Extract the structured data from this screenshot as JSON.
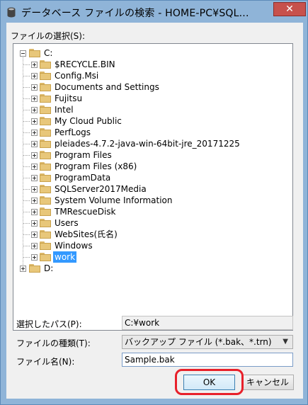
{
  "window": {
    "title": "データベース ファイルの検索 - HOME-PC¥SQL...",
    "close_glyph": "✕"
  },
  "dialog": {
    "file_select_label": "ファイルの選択(S):",
    "tree": {
      "drive_c": "C:",
      "folders": [
        {
          "name": "$RECYCLE.BIN"
        },
        {
          "name": "Config.Msi"
        },
        {
          "name": "Documents and Settings"
        },
        {
          "name": "Fujitsu"
        },
        {
          "name": "Intel"
        },
        {
          "name": "My Cloud Public"
        },
        {
          "name": "PerfLogs"
        },
        {
          "name": "pleiades-4.7.2-java-win-64bit-jre_20171225"
        },
        {
          "name": "Program Files"
        },
        {
          "name": "Program Files (x86)"
        },
        {
          "name": "ProgramData"
        },
        {
          "name": "SQLServer2017Media"
        },
        {
          "name": "System Volume Information"
        },
        {
          "name": "TMRescueDisk"
        },
        {
          "name": "Users"
        },
        {
          "name": "WebSites(氏名)"
        },
        {
          "name": "Windows"
        },
        {
          "name": "work"
        }
      ],
      "selected": "work",
      "drive_d": "D:"
    },
    "selected_path_label": "選択したパス(P):",
    "selected_path_value": "C:¥work",
    "file_type_label": "ファイルの種類(T):",
    "file_type_value": "バックアップ ファイル (*.bak、*.trn)",
    "file_name_label": "ファイル名(N):",
    "file_name_value": "Sample.bak",
    "ok_label": "OK",
    "cancel_label": "キャンセル"
  },
  "colors": {
    "title_bar": "#8fb4d8",
    "close_button": "#c7514c",
    "selection": "#3399ff",
    "annotation_highlight": "#e8202a"
  }
}
